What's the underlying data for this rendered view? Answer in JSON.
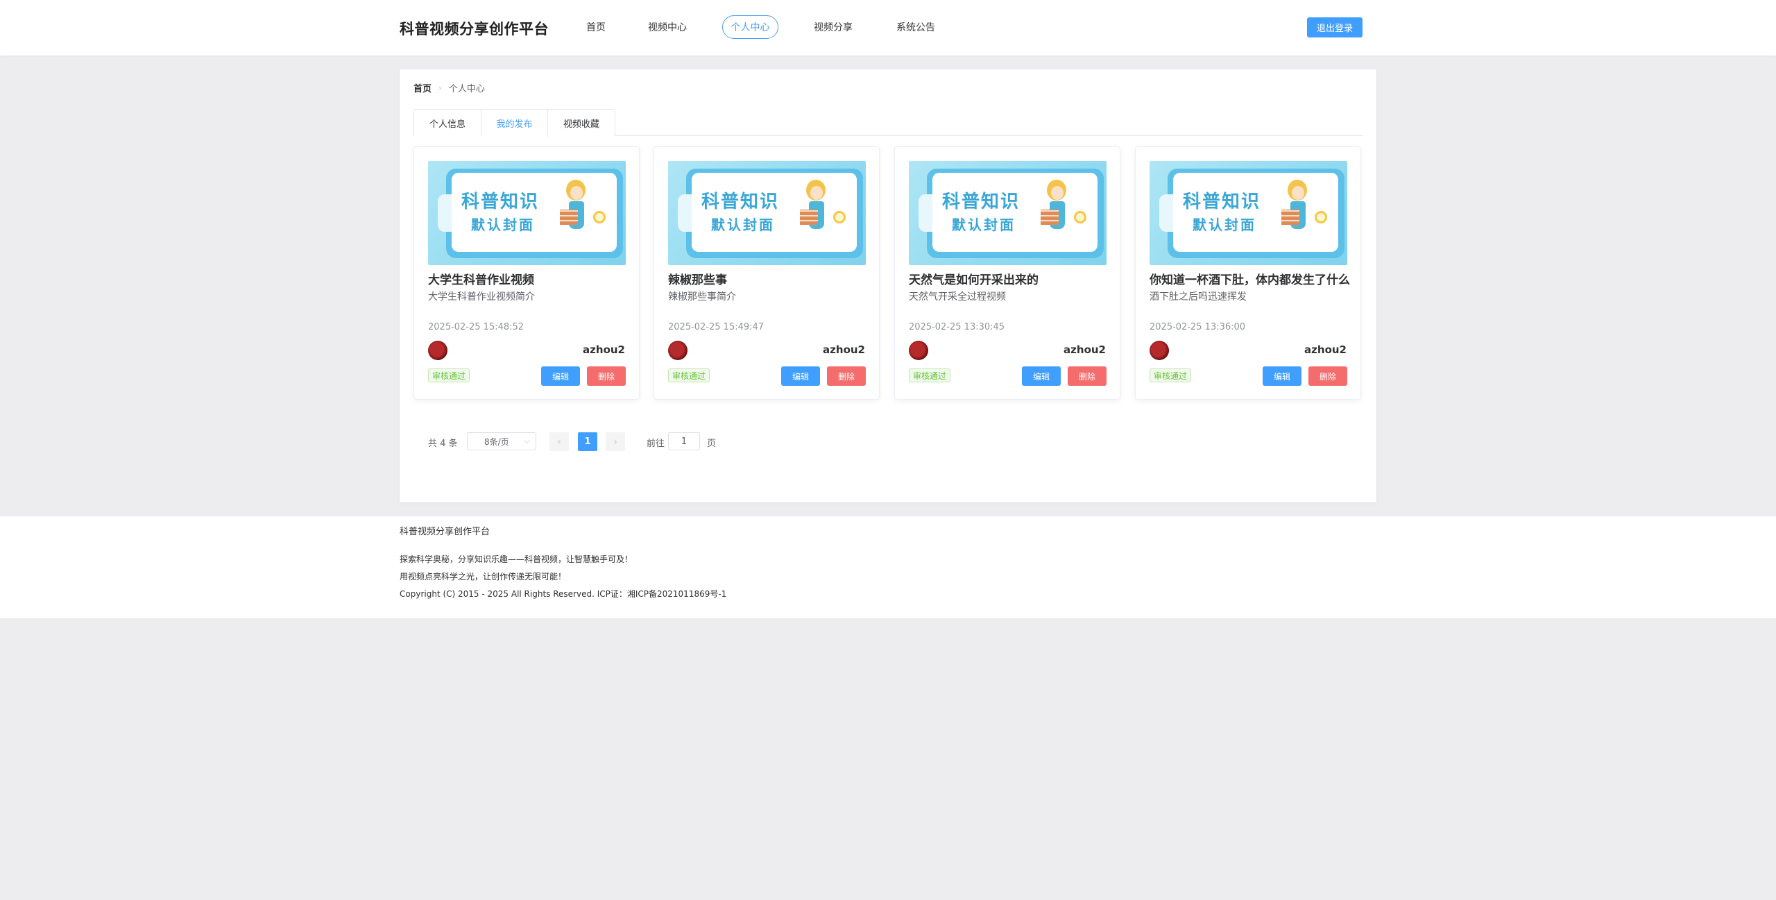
{
  "header": {
    "brand": "科普视频分享创作平台",
    "nav": [
      "首页",
      "视频中心",
      "个人中心",
      "视频分享",
      "系统公告"
    ],
    "active_nav": "个人中心",
    "logout_label": "退出登录"
  },
  "breadcrumb": {
    "home": "首页",
    "current": "个人中心"
  },
  "tabs": [
    "个人信息",
    "我的发布",
    "视频收藏"
  ],
  "active_tab": "我的发布",
  "cover": {
    "line1": "科普知识",
    "line2": "默认封面"
  },
  "cards": [
    {
      "title": "大学生科普作业视频",
      "desc": "大学生科普作业视频简介",
      "time": "2025-02-25 15:48:52",
      "author": "azhou2",
      "status": "审核通过",
      "edit": "编辑",
      "delete": "删除"
    },
    {
      "title": "辣椒那些事",
      "desc": "辣椒那些事简介",
      "time": "2025-02-25 15:49:47",
      "author": "azhou2",
      "status": "审核通过",
      "edit": "编辑",
      "delete": "删除"
    },
    {
      "title": "天然气是如何开采出来的",
      "desc": "天然气开采全过程视频",
      "time": "2025-02-25 13:30:45",
      "author": "azhou2",
      "status": "审核通过",
      "edit": "编辑",
      "delete": "删除"
    },
    {
      "title": "你知道一杯酒下肚，体内都发生了什么",
      "desc": "酒下肚之后吗迅速挥发",
      "time": "2025-02-25 13:36:00",
      "author": "azhou2",
      "status": "审核通过",
      "edit": "编辑",
      "delete": "删除"
    }
  ],
  "pagination": {
    "total": "共 4 条",
    "page_size": "8条/页",
    "current_page": "1",
    "goto_label": "前往",
    "goto_value": "1",
    "page_suffix": "页"
  },
  "footer": {
    "title": "科普视频分享创作平台",
    "line1": "探索科学奥秘，分享知识乐趣——科普视频，让智慧触手可及！",
    "line2": "用视频点亮科学之光，让创作传递无限可能！",
    "line3": "Copyright (C) 2015 - 2025 All Rights Reserved. ICP证：湘ICP备2021011869号-1"
  },
  "colors": {
    "primary": "#409eff",
    "danger": "#f56c6c",
    "success": "#67c23a",
    "page_bg": "#ededef"
  }
}
